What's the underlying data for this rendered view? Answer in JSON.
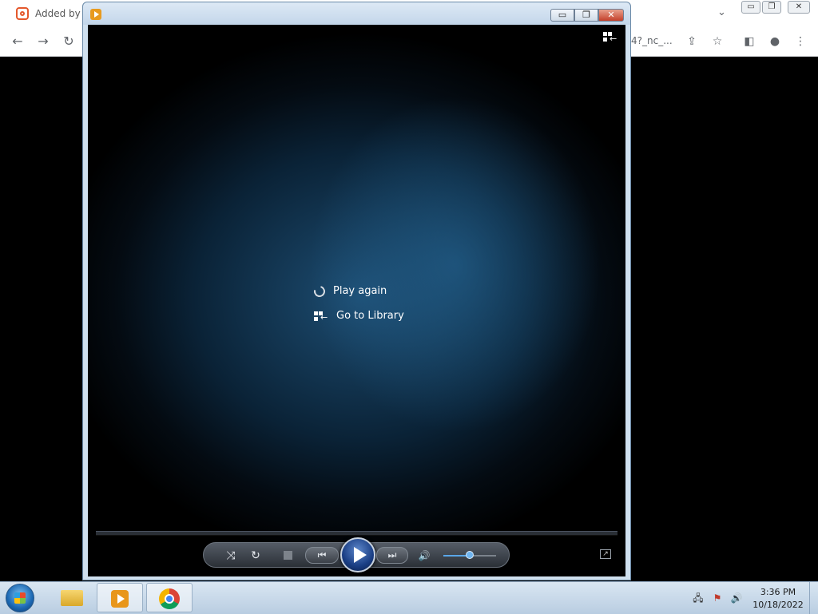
{
  "browser": {
    "tab_title": "Added by",
    "url_fragment": "4?_nc_..."
  },
  "wmp": {
    "title_buttons": {
      "minimize": "▭",
      "restore": "❐",
      "close": "✕"
    },
    "menu": [
      {
        "label": "Play again",
        "icon": "replay-icon"
      },
      {
        "label": "Go to Library",
        "icon": "switch-to-library-icon"
      }
    ],
    "controls": {
      "shuffle": "⤨",
      "repeat": "↻",
      "previous": "⏮",
      "next": "⏭",
      "mute": "🔊",
      "volume_fraction": 0.5
    }
  },
  "taskbar": {
    "apps": [
      "Windows Explorer",
      "Windows Media Player",
      "Google Chrome"
    ],
    "clock_time": "3:36 PM",
    "clock_date": "10/18/2022"
  },
  "colors": {
    "accent": "#5aa6e8",
    "close_red": "#c4402a",
    "viewport_bg": "#0a2236"
  }
}
